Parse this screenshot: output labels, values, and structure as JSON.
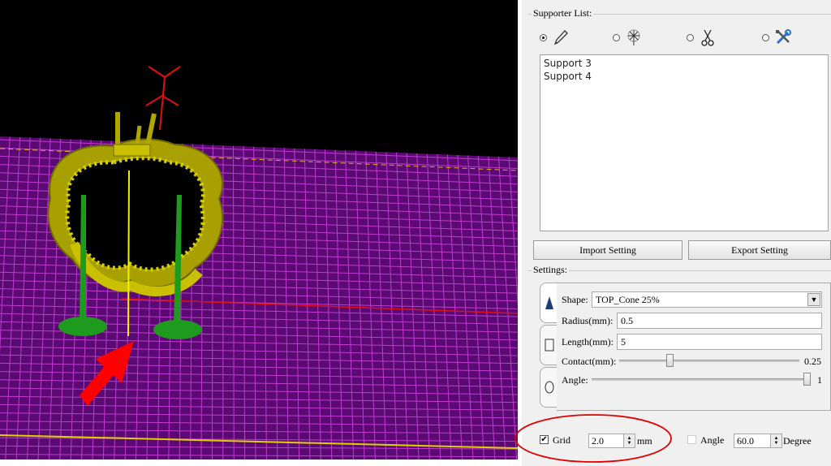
{
  "supporter_list": {
    "title": "Supporter List:",
    "tools": [
      {
        "icon": "pen-icon",
        "selected": true
      },
      {
        "icon": "dandelion-icon",
        "selected": false
      },
      {
        "icon": "scissors-icon",
        "selected": false
      },
      {
        "icon": "wrench-screwdriver-icon",
        "selected": false
      }
    ],
    "items": [
      "Support 3",
      "Support 4"
    ]
  },
  "buttons": {
    "import": "Import Setting",
    "export": "Export Setting"
  },
  "settings": {
    "title": "Settings:",
    "shape_label": "Shape:",
    "shape_value": "TOP_Cone 25%",
    "radius_label": "Radius(mm):",
    "radius_value": "0.5",
    "length_label": "Length(mm):",
    "length_value": "5",
    "contact_label": "Contact(mm):",
    "contact_value": "0.25",
    "contact_level": 0.25,
    "angle_label": "Angle:",
    "angle_value": "1",
    "angle_level": 1.0
  },
  "grid": {
    "checked": true,
    "label": "Grid",
    "value": "2.0",
    "unit": "mm"
  },
  "angle_snap": {
    "checked": false,
    "label": "Angle",
    "value": "60.0",
    "unit": "Degree"
  },
  "colors": {
    "grid_lines": "#9b1ea8",
    "model": "#c8c000",
    "supports": "#1e9a1e",
    "annotation": "#ff0000"
  }
}
